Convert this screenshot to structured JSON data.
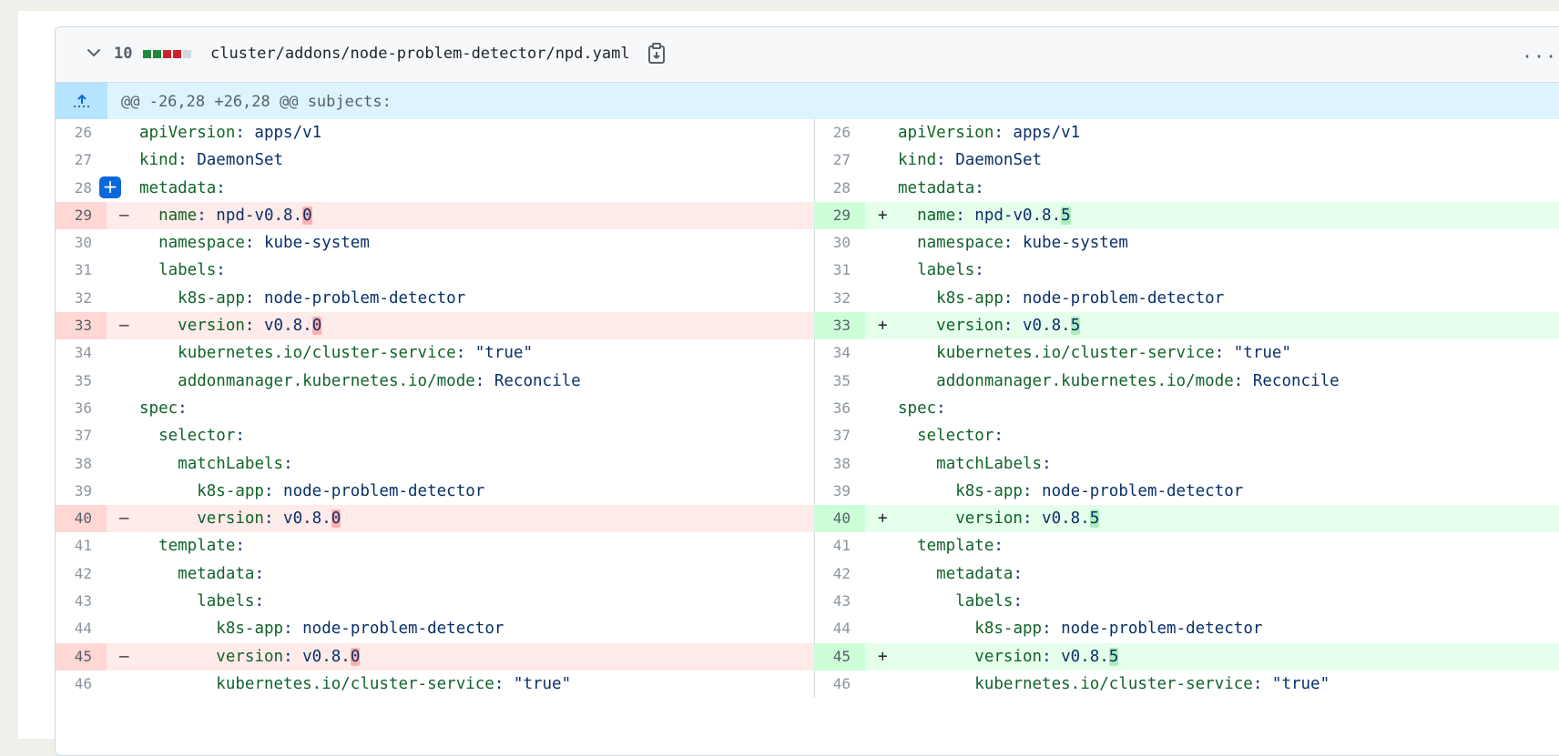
{
  "file": {
    "changes": "10",
    "path": "cluster/addons/node-problem-detector/npd.yaml",
    "stat_colors": [
      "#1f883d",
      "#1f883d",
      "#cf222e",
      "#cf222e",
      "#d1d9e0"
    ]
  },
  "hunk": {
    "header": "@@ -26,28 +26,28 @@ subjects:"
  },
  "rows": [
    {
      "n": "26",
      "type": "ctx",
      "indent": "",
      "key": "apiVersion",
      "rest": ": apps/v1"
    },
    {
      "n": "27",
      "type": "ctx",
      "indent": "",
      "key": "kind",
      "rest": ": DaemonSet"
    },
    {
      "n": "28",
      "type": "ctx",
      "indent": "",
      "key": "metadata",
      "rest": ":",
      "plus": true
    },
    {
      "n": "29",
      "type": "chg",
      "indent": "  ",
      "key": "name",
      "pre": ": npd-v0.8.",
      "old": "0",
      "new": "5"
    },
    {
      "n": "30",
      "type": "ctx",
      "indent": "  ",
      "key": "namespace",
      "rest": ": kube-system"
    },
    {
      "n": "31",
      "type": "ctx",
      "indent": "  ",
      "key": "labels",
      "rest": ":"
    },
    {
      "n": "32",
      "type": "ctx",
      "indent": "    ",
      "key": "k8s-app",
      "rest": ": node-problem-detector"
    },
    {
      "n": "33",
      "type": "chg",
      "indent": "    ",
      "key": "version",
      "pre": ": v0.8.",
      "old": "0",
      "new": "5"
    },
    {
      "n": "34",
      "type": "ctx",
      "indent": "    ",
      "key": "kubernetes.io/cluster-service",
      "rest": ": \"true\""
    },
    {
      "n": "35",
      "type": "ctx",
      "indent": "    ",
      "key": "addonmanager.kubernetes.io/mode",
      "rest": ": Reconcile"
    },
    {
      "n": "36",
      "type": "ctx",
      "indent": "",
      "key": "spec",
      "rest": ":"
    },
    {
      "n": "37",
      "type": "ctx",
      "indent": "  ",
      "key": "selector",
      "rest": ":"
    },
    {
      "n": "38",
      "type": "ctx",
      "indent": "    ",
      "key": "matchLabels",
      "rest": ":"
    },
    {
      "n": "39",
      "type": "ctx",
      "indent": "      ",
      "key": "k8s-app",
      "rest": ": node-problem-detector"
    },
    {
      "n": "40",
      "type": "chg",
      "indent": "      ",
      "key": "version",
      "pre": ": v0.8.",
      "old": "0",
      "new": "5"
    },
    {
      "n": "41",
      "type": "ctx",
      "indent": "  ",
      "key": "template",
      "rest": ":"
    },
    {
      "n": "42",
      "type": "ctx",
      "indent": "    ",
      "key": "metadata",
      "rest": ":"
    },
    {
      "n": "43",
      "type": "ctx",
      "indent": "      ",
      "key": "labels",
      "rest": ":"
    },
    {
      "n": "44",
      "type": "ctx",
      "indent": "        ",
      "key": "k8s-app",
      "rest": ": node-problem-detector"
    },
    {
      "n": "45",
      "type": "chg",
      "indent": "        ",
      "key": "version",
      "pre": ": v0.8.",
      "old": "0",
      "new": "5"
    },
    {
      "n": "46",
      "type": "ctx",
      "indent": "        ",
      "key": "kubernetes.io/cluster-service",
      "rest": ": \"true\""
    }
  ],
  "signs": {
    "del": "–",
    "add": "+"
  },
  "icons": {
    "expand": "expand-up-icon",
    "chevron": "chevron-down-icon",
    "copy": "copy-icon",
    "more": "kebab-icon",
    "plus": "add-comment-icon"
  },
  "more_label": "···",
  "plus_label": "+"
}
